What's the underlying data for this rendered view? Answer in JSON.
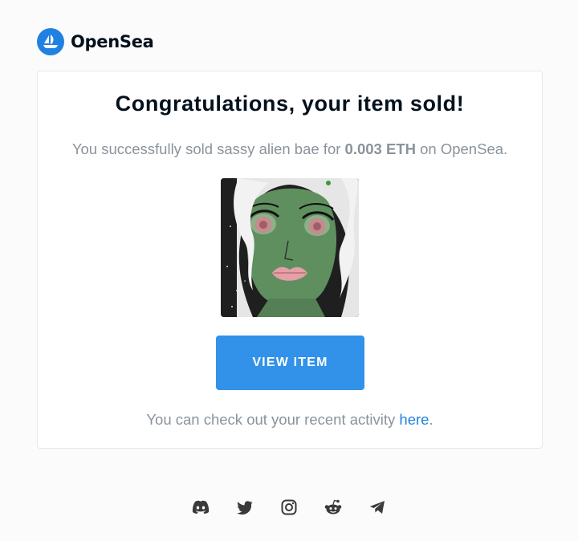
{
  "brand": {
    "name": "OpenSea",
    "color": "#2081e2"
  },
  "card": {
    "title": "Congratulations, your item sold!",
    "message": {
      "prefix": "You successfully sold sassy alien bae for ",
      "price": "0.003 ETH",
      "suffix": " on OpenSea."
    },
    "item_image_icon": "nft-artwork-green-alien",
    "view_button_label": "VIEW ITEM",
    "activity": {
      "prefix": "You can check out your recent activity ",
      "link_label": "here",
      "suffix": "."
    }
  },
  "social_icons": [
    "discord-icon",
    "twitter-icon",
    "instagram-icon",
    "reddit-icon",
    "telegram-icon"
  ],
  "colors": {
    "accent": "#2081e2",
    "button": "#3291e9",
    "muted_text": "#8a939b",
    "title_text": "#04111d"
  }
}
